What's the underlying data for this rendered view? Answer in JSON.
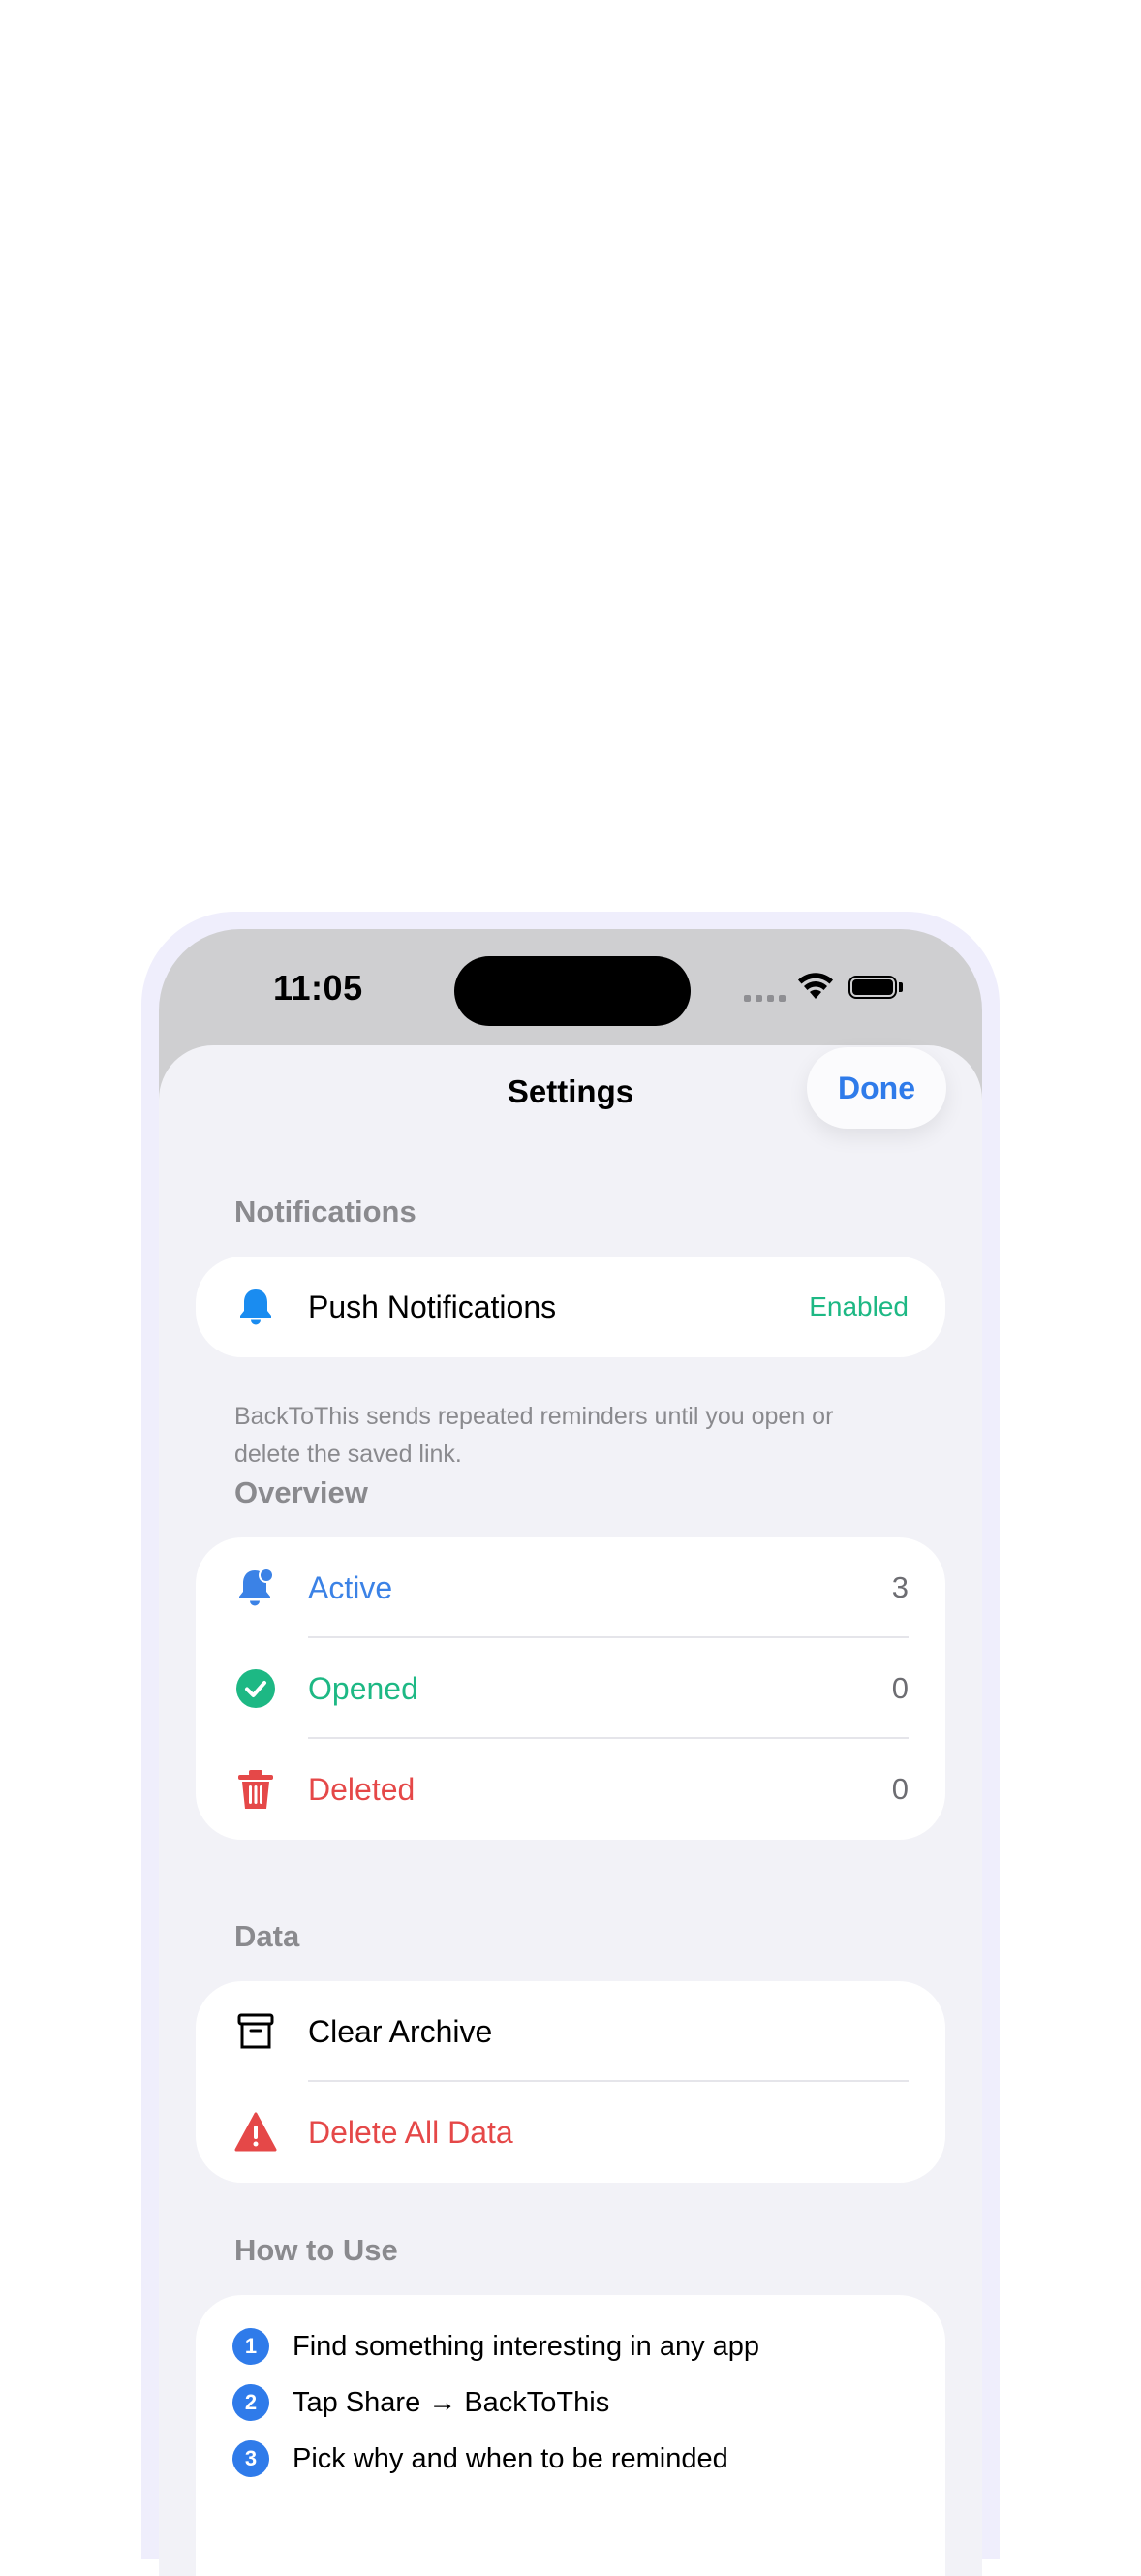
{
  "status_bar": {
    "time": "11:05"
  },
  "sheet": {
    "title": "Settings",
    "done_label": "Done"
  },
  "notifications": {
    "header": "Notifications",
    "push": {
      "label": "Push Notifications",
      "value": "Enabled",
      "value_color": "#1db884"
    },
    "footer": "BackToThis sends repeated reminders until you open or delete the saved link."
  },
  "overview": {
    "header": "Overview",
    "items": [
      {
        "label": "Active",
        "count": "3",
        "color": "#3b82e6",
        "icon": "bell-badge-icon"
      },
      {
        "label": "Opened",
        "count": "0",
        "color": "#1db884",
        "icon": "checkmark-circle-icon"
      },
      {
        "label": "Deleted",
        "count": "0",
        "color": "#e54848",
        "icon": "trash-icon"
      }
    ]
  },
  "data_section": {
    "header": "Data",
    "items": [
      {
        "label": "Clear Archive",
        "color": "#000000",
        "icon": "archive-box-icon"
      },
      {
        "label": "Delete All Data",
        "color": "#e54848",
        "icon": "warning-triangle-icon"
      }
    ]
  },
  "how_to_use": {
    "header": "How to Use",
    "steps": [
      {
        "num": "1",
        "text": "Find something interesting in any app"
      },
      {
        "num": "2",
        "text": "Tap Share → BackToThis"
      },
      {
        "num": "3",
        "text": "Pick why and when to be reminded"
      }
    ]
  },
  "colors": {
    "accent": "#2f7bea",
    "background": "#f2f2f7",
    "frame": "#efeefc"
  }
}
